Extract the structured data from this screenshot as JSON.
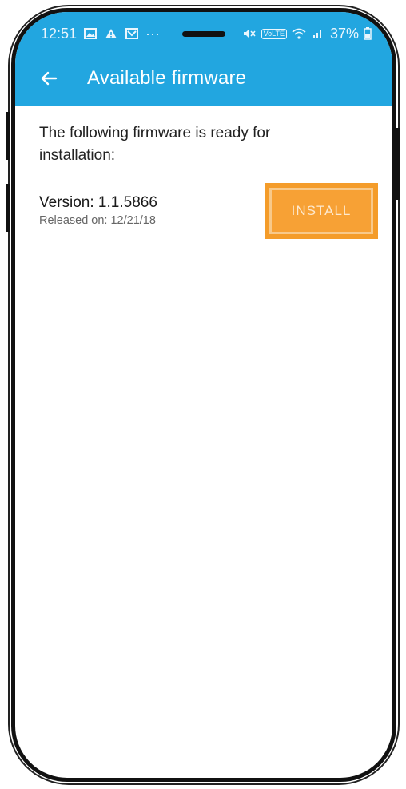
{
  "status_bar": {
    "time": "12:51",
    "icons_left": [
      "image-icon",
      "warning-icon",
      "mail-icon",
      "more-icon"
    ],
    "more_label": "···",
    "icons_right": [
      "mute-icon",
      "volte-icon",
      "wifi-icon",
      "signal-icon",
      "battery-icon"
    ],
    "volte_label": "VoLTE",
    "battery": "37%"
  },
  "app_bar": {
    "back_icon": "arrow-left-icon",
    "title": "Available firmware",
    "color": "#22a6e0"
  },
  "content": {
    "intro": "The following firmware is ready for installation:",
    "firmware": {
      "version": "Version: 1.1.5866",
      "released": "Released on: 12/21/18",
      "install_label": "INSTALL",
      "accent": "#f49c2a"
    }
  }
}
